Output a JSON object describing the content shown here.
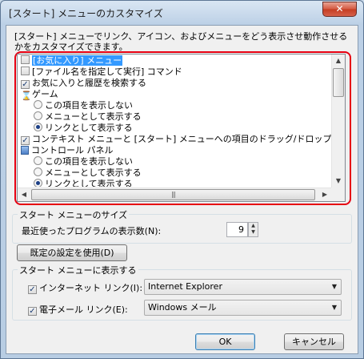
{
  "window": {
    "title": "[スタート] メニューのカスタマイズ",
    "close_glyph": "✕"
  },
  "description": "[スタート] メニューでリンク、アイコン、およびメニューをどう表示させ動作させるかをカスタマイズできます。",
  "options": {
    "favorites_menu": {
      "label": "[お気に入り] メニュー",
      "checked": false
    },
    "run_command": {
      "label": "[ファイル名を指定して実行] コマンド",
      "checked": false
    },
    "search_favorites_history": {
      "label": "お気に入りと履歴を検索する",
      "checked": true
    },
    "games": {
      "label": "ゲーム",
      "icon": "hourglass-icon",
      "choices": [
        "この項目を表示しない",
        "メニューとして表示する",
        "リンクとして表示する"
      ],
      "selected": "リンクとして表示する"
    },
    "drag_drop": {
      "label": "コンテキスト メニューと [スタート] メニューへの項目のドラッグ/ドロップを有効化する",
      "checked": true
    },
    "control_panel": {
      "label": "コントロール パネル",
      "icon": "control-panel-icon",
      "choices": [
        "この項目を表示しない",
        "メニューとして表示する",
        "リンクとして表示する"
      ],
      "selected": "リンクとして表示する"
    }
  },
  "scrollbars": {
    "up": "▲",
    "down": "▼",
    "left": "◀",
    "right": "▶",
    "grip": "|||"
  },
  "size_group": {
    "title": "スタート メニューのサイズ",
    "recent_programs_label": "最近使ったプログラムの表示数(N):",
    "recent_programs_value": "9"
  },
  "default_button": "既定の設定を使用(D)",
  "show_group": {
    "title": "スタート メニューに表示する",
    "internet": {
      "label": "インターネット リンク(I):",
      "checked": true,
      "value": "Internet Explorer"
    },
    "email": {
      "label": "電子メール リンク(E):",
      "checked": true,
      "value": "Windows メール"
    }
  },
  "buttons": {
    "ok": "OK",
    "cancel": "キャンセル"
  },
  "colors": {
    "highlight": "#3399ff",
    "annotation_frame": "#e60012"
  }
}
